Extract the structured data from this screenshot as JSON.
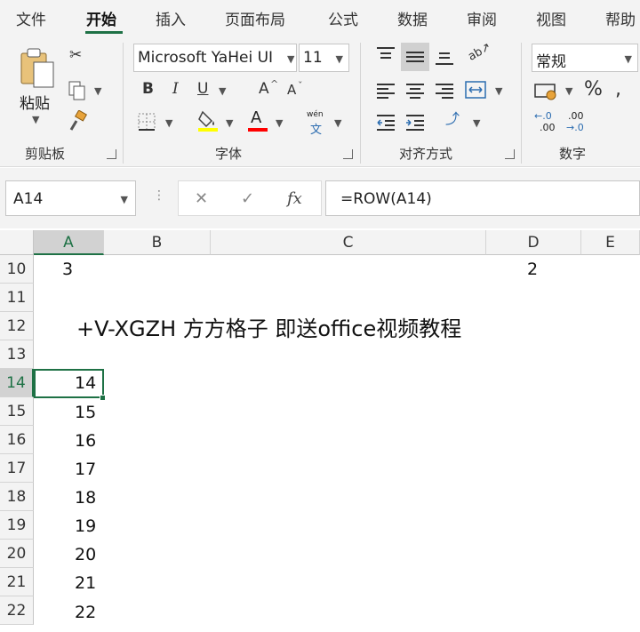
{
  "tabs": [
    {
      "label": "文件"
    },
    {
      "label": "开始"
    },
    {
      "label": "插入"
    },
    {
      "label": "页面布局"
    },
    {
      "label": "公式"
    },
    {
      "label": "数据"
    },
    {
      "label": "审阅"
    },
    {
      "label": "视图"
    },
    {
      "label": "帮助"
    }
  ],
  "ribbon": {
    "clipboard": {
      "paste_label": "粘贴",
      "group_label": "剪贴板"
    },
    "font": {
      "font_name": "Microsoft YaHei UI",
      "font_size": "11",
      "group_label": "字体",
      "bold": "B",
      "italic": "I",
      "underline": "U",
      "grow": "A",
      "shrink": "A",
      "font_color": "A",
      "phonetic_top": "wén",
      "phonetic_bottom": "文"
    },
    "alignment": {
      "group_label": "对齐方式"
    },
    "number": {
      "format": "常规",
      "group_label": "数字",
      "percent": "%",
      "inc_top": "←.0",
      "inc_bottom": ".00",
      "dec_top": ".00",
      "dec_bottom": "→.0"
    }
  },
  "formula_bar": {
    "name_box": "A14",
    "cancel": "✕",
    "enter": "✓",
    "fx": "fx",
    "formula": "=ROW(A14)"
  },
  "sheet": {
    "columns": [
      "A",
      "B",
      "C",
      "D",
      "E"
    ],
    "rows": [
      "10",
      "11",
      "12",
      "13",
      "14",
      "15",
      "16",
      "17",
      "18",
      "19",
      "20",
      "21",
      "22"
    ],
    "cells": {
      "A10": "3",
      "D10": "2",
      "A14": "14",
      "A15": "15",
      "A16": "16",
      "A17": "17",
      "A18": "18",
      "A19": "19",
      "A20": "20",
      "A21": "21",
      "A22": "22"
    },
    "note": "+V-XGZH   方方格子   即送office视频教程"
  }
}
